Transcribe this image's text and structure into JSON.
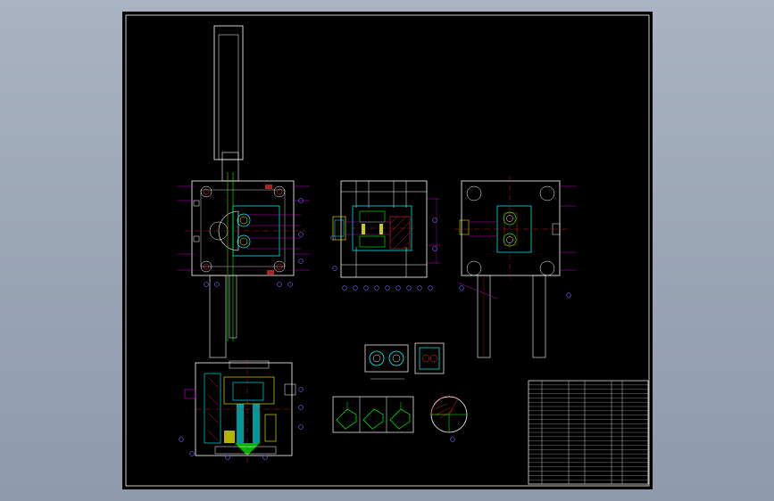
{
  "drawing": {
    "section_label": "",
    "scale_label": "",
    "colors": {
      "background": "#000000",
      "frame": "#ffffff",
      "dimension": "#ff00ff",
      "balloon": "#6a6aff",
      "center": "#ff2020",
      "part": "#ffffff",
      "cavity": "#00ffff",
      "hatch": "#ff3030",
      "green": "#00ff00",
      "yellow": "#ffff00"
    }
  },
  "title_block": {
    "rows": 24
  }
}
